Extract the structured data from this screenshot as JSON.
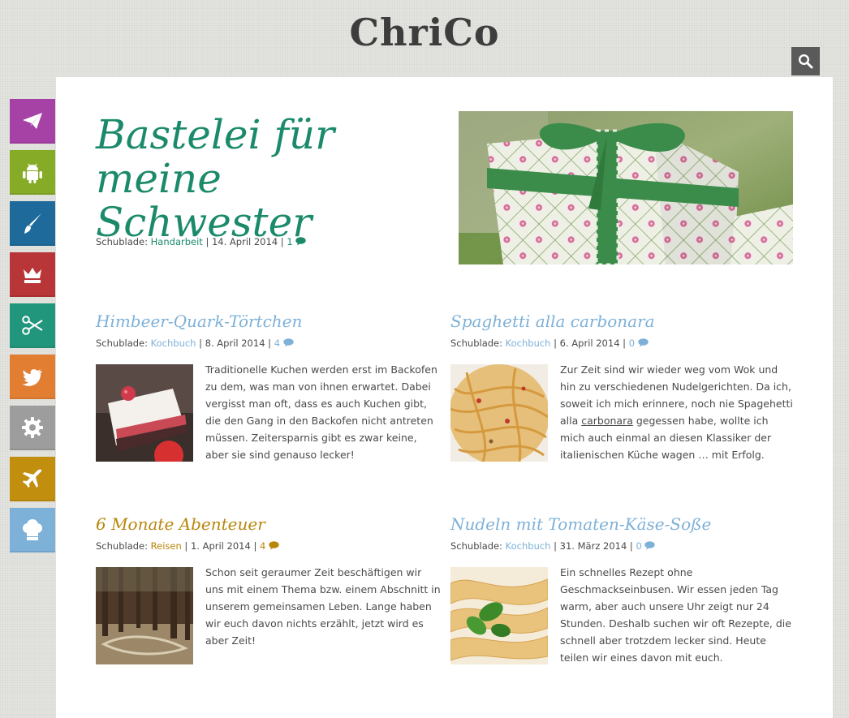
{
  "site": {
    "logo": "ChriCo"
  },
  "search": {
    "icon": "search-icon"
  },
  "sidebar": {
    "items": [
      {
        "icon": "paper-plane-icon",
        "color": "#a641a6"
      },
      {
        "icon": "android-icon",
        "color": "#86ab27"
      },
      {
        "icon": "paintbrush-icon",
        "color": "#1d6a9b"
      },
      {
        "icon": "crown-icon",
        "color": "#b83538"
      },
      {
        "icon": "scissors-icon",
        "color": "#22967c"
      },
      {
        "icon": "twitter-icon",
        "color": "#e27e32"
      },
      {
        "icon": "gear-icon",
        "color": "#9d9d9d"
      },
      {
        "icon": "airplane-icon",
        "color": "#c18e0e"
      },
      {
        "icon": "chef-hat-icon",
        "color": "#7eb1d8"
      }
    ]
  },
  "featured": {
    "title": "Bastelei für meine Schwester",
    "meta_prefix": "Schublade:",
    "category": "Handarbeit",
    "date": "14. April 2014",
    "comments": "1",
    "color": "#1b8a6b",
    "image_alt": "gift-box-photo"
  },
  "posts": [
    {
      "title": "Himbeer-Quark-Törtchen",
      "meta_prefix": "Schublade:",
      "category": "Kochbuch",
      "date": "8. April 2014",
      "comments": "4",
      "color": "#7eb1d8",
      "excerpt": "Traditionelle Kuchen werden erst im Backofen zu dem, was man von ihnen erwartet. Dabei vergisst man oft, dass es auch Kuchen gibt, die den Gang in den Backofen nicht antreten müssen. Zeitersparnis gibt es zwar keine, aber sie sind genauso lecker!"
    },
    {
      "title": "Spaghetti alla carbonara",
      "meta_prefix": "Schublade:",
      "category": "Kochbuch",
      "date": "6. April 2014",
      "comments": "0",
      "color": "#7eb1d8",
      "excerpt_before": "Zur Zeit sind wir wieder weg vom Wok und hin zu verschiedenen Nudelgerichten. Da ich, soweit ich mich erinnere, noch nie Spagehetti alla ",
      "excerpt_link": "carbonara",
      "excerpt_after": " gegessen habe, wollte ich mich auch einmal an diesen Klassiker der italienischen Küche wagen … mit Erfolg."
    },
    {
      "title": "6 Monate Abenteuer",
      "meta_prefix": "Schublade:",
      "category": "Reisen",
      "date": "1. April 2014",
      "comments": "4",
      "color": "#b8860b",
      "excerpt": "Schon seit geraumer Zeit beschäftigen wir uns mit einem Thema bzw. einem Abschnitt in unserem gemeinsamen Leben. Lange haben wir euch davon nichts erzählt, jetzt wird es aber Zeit!"
    },
    {
      "title": "Nudeln mit Tomaten-Käse-Soße",
      "meta_prefix": "Schublade:",
      "category": "Kochbuch",
      "date": "31. März 2014",
      "comments": "0",
      "color": "#7eb1d8",
      "excerpt": "Ein schnelles Rezept ohne Geschmackseinbusen. Wir essen jeden Tag warm, aber auch unsere Uhr zeigt nur 24 Stunden. Deshalb suchen wir oft Rezepte, die schnell aber trotzdem lecker sind. Heute teilen wir eines davon mit euch."
    }
  ]
}
